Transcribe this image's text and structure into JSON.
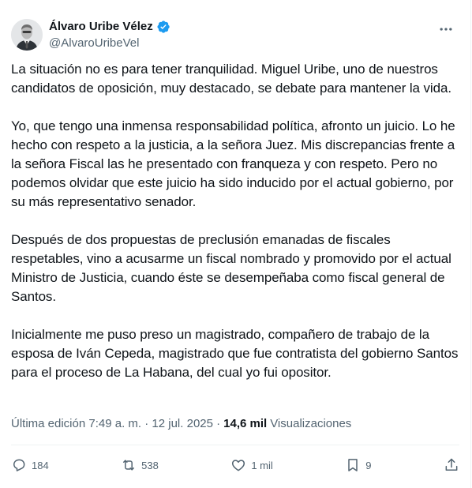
{
  "author": {
    "display_name": "Álvaro Uribe Vélez",
    "handle": "@AlvaroUribeVel",
    "verified_icon": "verified-badge-icon",
    "verified_color": "#1d9bf0"
  },
  "post": {
    "paragraphs": [
      "La situación no es para tener tranquilidad. Miguel Uribe, uno de nuestros candidatos de oposición, muy destacado, se debate para mantener la vida.",
      "Yo, que tengo una inmensa responsabilidad política, afronto un juicio. Lo he hecho con respeto a la justicia, a la señora Juez. Mis discrepancias frente a la señora Fiscal las he presentado con franqueza y con respeto. Pero no podemos olvidar que este juicio ha sido inducido por el actual gobierno, por su más representativo senador.",
      "Después de dos propuestas de preclusión emanadas de fiscales respetables, vino a acusarme un fiscal nombrado y promovido por el actual Ministro de Justicia, cuando éste se desempeñaba como fiscal general de Santos.",
      "Inicialmente me puso preso un magistrado, compañero de trabajo de la esposa de Iván Cepeda, magistrado que fue contratista del gobierno Santos para el proceso de La Habana, del cual yo fui opositor."
    ]
  },
  "meta": {
    "edited": "Última edición 7:49 a. m. · 12 jul. 2025 ·",
    "views_count": "14,6 mil",
    "views_label": "Visualizaciones"
  },
  "actions": {
    "replies": "184",
    "reposts": "538",
    "likes": "1 mil",
    "bookmarks": "9"
  },
  "colors": {
    "text": "#0f1419",
    "secondary": "#536471",
    "divider": "#eff3f4"
  }
}
